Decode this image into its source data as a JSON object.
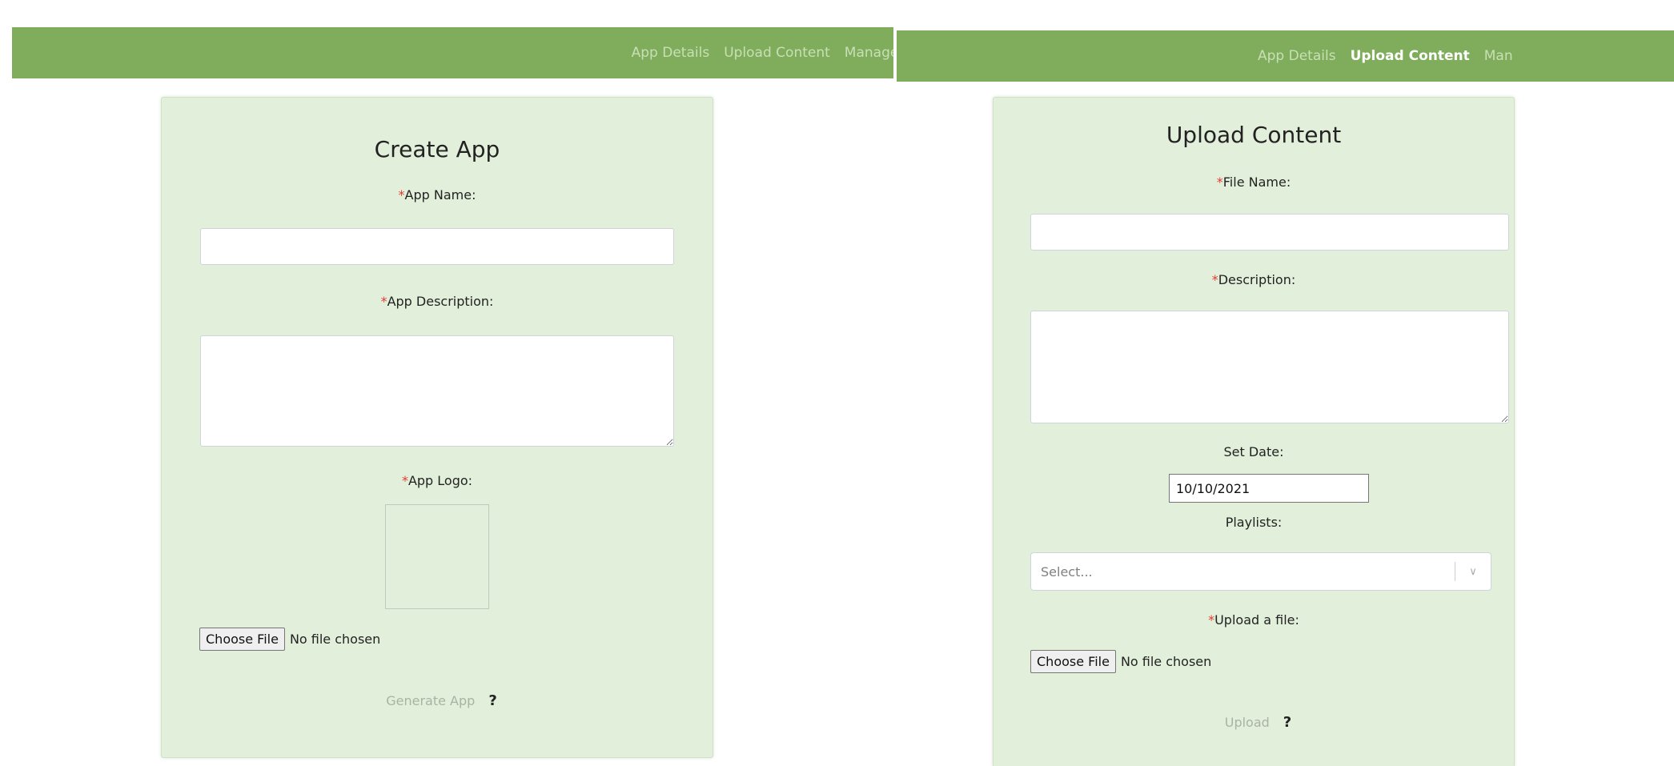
{
  "left": {
    "nav": {
      "links": [
        "App Details",
        "Upload Content",
        "Manage Co"
      ]
    },
    "form": {
      "title": "Create App",
      "fields": {
        "app_name_label": "App Name:",
        "app_description_label": "App Description:",
        "app_logo_label": "App Logo:"
      },
      "required_mark": "*",
      "app_name_value": "",
      "app_description_value": "",
      "file": {
        "button": "Choose File",
        "status": "No file chosen"
      },
      "submit": "Generate App",
      "help": "?"
    }
  },
  "right": {
    "nav": {
      "links": [
        "App Details",
        "Upload Content",
        "Man"
      ],
      "active": "Upload Content"
    },
    "form": {
      "title": "Upload Content",
      "required_mark": "*",
      "fields": {
        "file_name_label": "File Name:",
        "description_label": "Description:",
        "set_date_label": "Set Date:",
        "playlists_label": "Playlists:",
        "upload_label": "Upload a file:"
      },
      "file_name_value": "",
      "description_value": "",
      "date_value": "10/10/2021",
      "playlists_placeholder": "Select...",
      "file": {
        "button": "Choose File",
        "status": "No file chosen"
      },
      "submit": "Upload",
      "help": "?"
    }
  },
  "colors": {
    "navbar": "#7fad5b",
    "card": "#e2f0db",
    "required": "#e53935"
  }
}
